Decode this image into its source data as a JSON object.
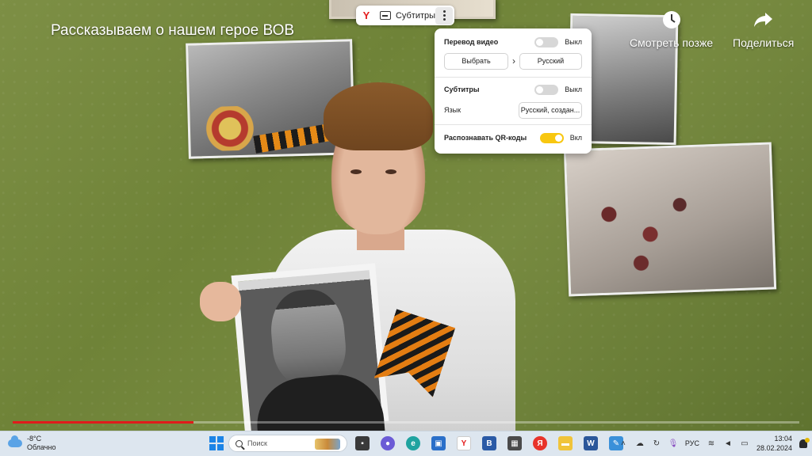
{
  "video": {
    "title": "Рассказываем о нашем герое ВОВ",
    "actions": {
      "watch_later": "Смотреть позже",
      "share": "Поделиться"
    },
    "progress_fraction": 0.23
  },
  "toolbar": {
    "logo": "Y",
    "subtitles_label": "Субтитры"
  },
  "panel": {
    "translate": {
      "label": "Перевод видео",
      "state": "Выкл",
      "from_button": "Выбрать",
      "to_button": "Русский"
    },
    "subtitles": {
      "label": "Субтитры",
      "state": "Выкл",
      "language_label": "Язык",
      "language_value": "Русский, создан..."
    },
    "qr": {
      "label": "Распознавать QR-коды",
      "state": "Вкл"
    }
  },
  "taskbar": {
    "weather": {
      "temp": "-8°C",
      "condition": "Облачно"
    },
    "search_placeholder": "Поиск",
    "apps": [
      "file-explorer-app-icon",
      "task-view-icon",
      "chat-icon",
      "edge-icon",
      "store-icon",
      "yandex-browser-icon",
      "vk-icon",
      "calculator-icon",
      "yandex-icon",
      "folder-icon",
      "word-icon",
      "paint-icon"
    ],
    "tray": {
      "language": "РУС",
      "time": "13:04",
      "date": "28.02.2024"
    }
  },
  "colors": {
    "accent_yellow": "#f8c710",
    "progress_red": "#e01b1b",
    "toggle_off": "#d7d7d7"
  }
}
